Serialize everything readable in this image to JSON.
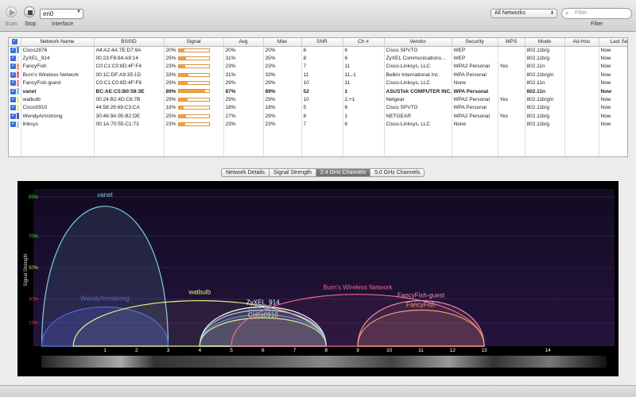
{
  "toolbar": {
    "scan_label": "Scan",
    "stop_label": "Stop",
    "interface_value": "en0",
    "interface_label": "Interface",
    "network_filter_value": "All Networks",
    "filter_placeholder": "Filter",
    "filter_label": "Filter"
  },
  "table": {
    "columns": [
      "",
      "Network Name",
      "BSSID",
      "Signal",
      "Avg",
      "Max",
      "SNR",
      "Ch #",
      "Vendor",
      "Security",
      "WPS",
      "Mode",
      "Ad-Hoc",
      "Last Seen"
    ],
    "rows": [
      {
        "name": "Cisco2876",
        "color": "#5b8ed6",
        "bssid": "A4:A2:4A:7E:D7:9A",
        "signal": "20%",
        "signal_value": 20,
        "avg": "20%",
        "max": "20%",
        "snr": "6",
        "ch": "6",
        "vendor": "Cisco SPVTG",
        "security": "WEP",
        "wps": "",
        "mode": "802.11b/g",
        "adhoc": "",
        "last_seen": "Now",
        "bold": false
      },
      {
        "name": "ZyXEL_914",
        "color": "#e8e8e8",
        "bssid": "00:23:F8:84:A9:14",
        "signal": "25%",
        "signal_value": 25,
        "avg": "31%",
        "max": "35%",
        "snr": "8",
        "ch": "6",
        "vendor": "ZyXEL Communications…",
        "security": "WEP",
        "wps": "",
        "mode": "802.11b/g",
        "adhoc": "",
        "last_seen": "Now",
        "bold": false
      },
      {
        "name": "FancyFish",
        "color": "#f0a070",
        "bssid": "C0:C1:C0:8D:4F:F4",
        "signal": "23%",
        "signal_value": 23,
        "avg": "23%",
        "max": "23%",
        "snr": "7",
        "ch": "11",
        "vendor": "Cisco-Linksys, LLC",
        "security": "WPA2 Personal",
        "wps": "Yes",
        "mode": "802.11n",
        "adhoc": "",
        "last_seen": "Now",
        "bold": false
      },
      {
        "name": "Burn's Wireless Network",
        "color": "#f06a8a",
        "bssid": "00:1C:DF:A9:35:1D",
        "signal": "33%",
        "signal_value": 33,
        "avg": "31%",
        "max": "33%",
        "snr": "11",
        "ch": "11,-1",
        "vendor": "Belkin International Inc.",
        "security": "WPA Personal",
        "wps": "",
        "mode": "802.11b/g/n",
        "adhoc": "",
        "last_seen": "Now",
        "bold": false
      },
      {
        "name": "FancyFish-guest",
        "color": "#f090b0",
        "bssid": "C0:C1:C0:8D:4F:F6",
        "signal": "29%",
        "signal_value": 29,
        "avg": "29%",
        "max": "29%",
        "snr": "10",
        "ch": "11",
        "vendor": "Cisco-Linksys, LLC",
        "security": "None",
        "wps": "",
        "mode": "802.11n",
        "adhoc": "",
        "last_seen": "Now",
        "bold": false
      },
      {
        "name": "vanet",
        "color": "#7ecfe6",
        "bssid": "BC:AE:C5:B0:59:3E",
        "signal": "89%",
        "signal_value": 89,
        "avg": "87%",
        "max": "89%",
        "snr": "52",
        "ch": "1",
        "vendor": "ASUSTek COMPUTER INC.",
        "security": "WPA Personal",
        "wps": "",
        "mode": "802.11n",
        "adhoc": "",
        "last_seen": "Now",
        "bold": true
      },
      {
        "name": "watbulb",
        "color": "#e6f08a",
        "bssid": "00:24:B2:4D:C6:7B",
        "signal": "29%",
        "signal_value": 29,
        "avg": "29%",
        "max": "29%",
        "snr": "10",
        "ch": "2,+1",
        "vendor": "Netgear",
        "security": "WPA2 Personal",
        "wps": "Yes",
        "mode": "802.11b/g/n",
        "adhoc": "",
        "last_seen": "Now",
        "bold": false
      },
      {
        "name": "Cisco0910",
        "color": "#d8f0a0",
        "bssid": "44:58:29:69:C3:CA",
        "signal": "18%",
        "signal_value": 18,
        "avg": "18%",
        "max": "18%",
        "snr": "5",
        "ch": "6",
        "vendor": "Cisco SPVTG",
        "security": "WPA Personal",
        "wps": "",
        "mode": "802.11b/g",
        "adhoc": "",
        "last_seen": "Now",
        "bold": false
      },
      {
        "name": "WendyArmstrong",
        "color": "#4a5ed0",
        "bssid": "30:46:9A:95:B2:DE",
        "signal": "25%",
        "signal_value": 25,
        "avg": "27%",
        "max": "29%",
        "snr": "8",
        "ch": "1",
        "vendor": "NETGEAR",
        "security": "WPA2 Personal",
        "wps": "Yes",
        "mode": "802.11b/g",
        "adhoc": "",
        "last_seen": "Now",
        "bold": false
      },
      {
        "name": "linksys",
        "color": "#b0d0f0",
        "bssid": "00:1A:70:55:C1:73",
        "signal": "23%",
        "signal_value": 23,
        "avg": "23%",
        "max": "23%",
        "snr": "7",
        "ch": "6",
        "vendor": "Cisco-Linksys, LLC",
        "security": "None",
        "wps": "",
        "mode": "802.11b/g",
        "adhoc": "",
        "last_seen": "Now",
        "bold": false
      }
    ]
  },
  "tabs": [
    {
      "label": "Network Details",
      "active": false
    },
    {
      "label": "Signal Strength",
      "active": false
    },
    {
      "label": "2.4 GHz Channels",
      "active": true
    },
    {
      "label": "5.0 GHz Channels",
      "active": false
    }
  ],
  "chart_data": {
    "type": "area",
    "ylabel": "Signal Strength",
    "yticks": [
      "95%",
      "70%",
      "50%",
      "30%",
      "15%"
    ],
    "ytick_values": [
      95,
      70,
      50,
      30,
      15
    ],
    "ytick_colors": [
      "#39e23a",
      "#39e23a",
      "#e3d23b",
      "#e23a3a",
      "#e23a3a"
    ],
    "xticks": [
      "1",
      "2",
      "3",
      "4",
      "5",
      "6",
      "7",
      "8",
      "9",
      "10",
      "11",
      "12",
      "13",
      "14"
    ],
    "xtick_values": [
      1,
      2,
      3,
      4,
      5,
      6,
      7,
      8,
      9,
      10,
      11,
      12,
      13,
      14
    ],
    "series": [
      {
        "name": "vanet",
        "center": 1,
        "from": -1,
        "to": 3,
        "level": 89,
        "color": "#7ecfe6",
        "fill": "rgba(126,207,230,0.12)",
        "label_dy": -12
      },
      {
        "name": "WendyArmstrong",
        "center": 1,
        "from": -1,
        "to": 3,
        "level": 25,
        "color": "#5068d8",
        "fill": "rgba(80,104,216,0.25)",
        "label_dy": -8
      },
      {
        "name": "watbulb",
        "center": 4,
        "from": 0,
        "to": 8,
        "level": 29,
        "color": "#e6f08a",
        "fill": "rgba(230,240,138,0.06)",
        "label_dy": -8
      },
      {
        "name": "ZyXEL_914",
        "center": 6,
        "from": 4,
        "to": 8,
        "level": 25,
        "color": "#ffffff",
        "fill": "rgba(255,255,255,0.08)",
        "label_dy": -3
      },
      {
        "name": "Cisco2876",
        "center": 6,
        "from": 4,
        "to": 8,
        "level": 20,
        "color": "#5b8ed6",
        "fill": "rgba(91,142,214,0.08)",
        "label_dy": -2
      },
      {
        "name": "linksys",
        "center": 6,
        "from": 4,
        "to": 8,
        "level": 23,
        "color": "#b0d0f0",
        "fill": "rgba(176,208,240,0.08)",
        "label_dy": -2
      },
      {
        "name": "Cisco0910",
        "center": 6,
        "from": 4,
        "to": 8,
        "level": 18,
        "color": "#d8f0a0",
        "fill": "rgba(216,240,160,0.08)",
        "label_dy": -1
      },
      {
        "name": "Burn's Wireless Network",
        "center": 9,
        "from": 5,
        "to": 13,
        "level": 33,
        "color": "#f06a8a",
        "fill": "rgba(240,106,138,0.06)",
        "label_dy": -6
      },
      {
        "name": "FancyFish-guest",
        "center": 11,
        "from": 9,
        "to": 13,
        "level": 29,
        "color": "#f090b0",
        "fill": "rgba(240,144,176,0.10)",
        "label_dy": -4
      },
      {
        "name": "FancyFish",
        "center": 11,
        "from": 9,
        "to": 13,
        "level": 23,
        "color": "#f0a070",
        "fill": "rgba(240,160,112,0.12)",
        "label_dy": -4
      }
    ]
  }
}
